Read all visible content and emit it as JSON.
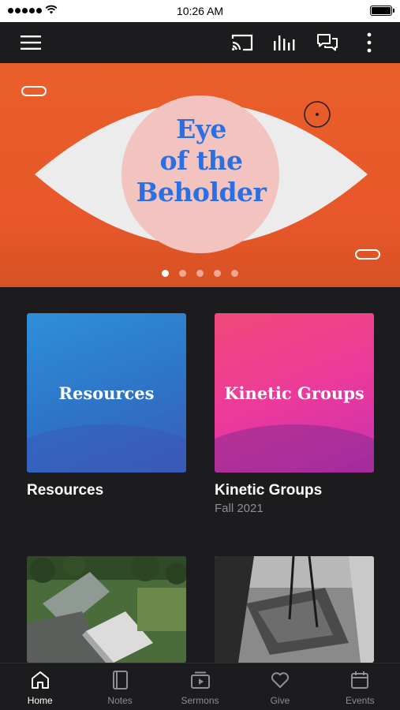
{
  "status_bar": {
    "time": "10:26 AM"
  },
  "hero": {
    "title_line1": "Eye",
    "title_line2": "of the",
    "title_line3": "Beholder",
    "slide_count": 5,
    "active_slide": 1
  },
  "cards": [
    {
      "image_text": "Resources",
      "title": "Resources",
      "subtitle": ""
    },
    {
      "image_text": "Kinetic Groups",
      "title": "Kinetic Groups",
      "subtitle": "Fall 2021"
    }
  ],
  "tabs": [
    {
      "label": "Home",
      "icon": "home-icon",
      "active": true
    },
    {
      "label": "Notes",
      "icon": "notes-icon",
      "active": false
    },
    {
      "label": "Sermons",
      "icon": "sermons-icon",
      "active": false
    },
    {
      "label": "Give",
      "icon": "heart-icon",
      "active": false
    },
    {
      "label": "Events",
      "icon": "calendar-icon",
      "active": false
    }
  ],
  "colors": {
    "hero_background": "#e95f2a",
    "hero_title": "#2b6fe0",
    "app_background": "#1c1c1e"
  }
}
